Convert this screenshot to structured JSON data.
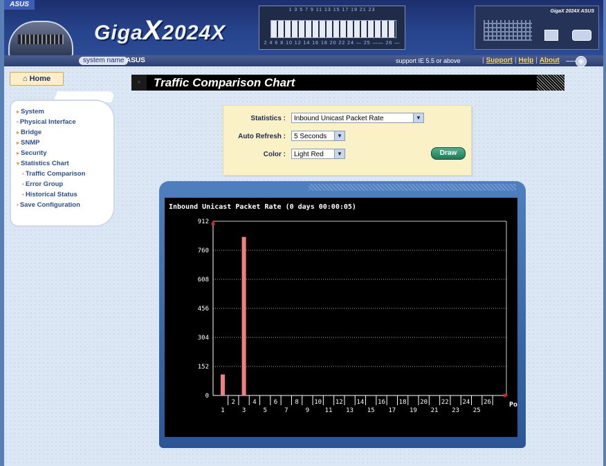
{
  "header": {
    "asus_logo": "ASUS",
    "brand_prefix": "Giga",
    "brand_x": "X",
    "brand_model": "2024X",
    "port_numbers_top": "1 3 5 7 9 11 13 15 17 19 21 23",
    "port_numbers_bottom": "2 4 6 8 10 12 14 16 18 20 22 24 — 25 —— 26 —",
    "device_label": "GigaX 2024X ASUS"
  },
  "statusbar": {
    "system_name_label": "system name",
    "system_name_value": "ASUS",
    "support_note": "support IE 5.5 or above",
    "links": {
      "support": "Support",
      "help": "Help",
      "about": "About"
    }
  },
  "nav": {
    "home": "Home",
    "items": [
      {
        "label": "System"
      },
      {
        "label": "Physical Interface"
      },
      {
        "label": "Bridge"
      },
      {
        "label": "SNMP"
      },
      {
        "label": "Security"
      },
      {
        "label": "Statistics Chart"
      },
      {
        "label": "Traffic Comparison"
      },
      {
        "label": "Error Group"
      },
      {
        "label": "Historical Status"
      },
      {
        "label": "Save Configuration"
      }
    ]
  },
  "page": {
    "title": "Traffic Comparison Chart"
  },
  "form": {
    "statistics_label": "Statistics :",
    "statistics_value": "Inbound Unicast Packet Rate",
    "refresh_label": "Auto Refresh :",
    "refresh_value": "5 Seconds",
    "color_label": "Color :",
    "color_value": "Light Red",
    "draw_button": "Draw"
  },
  "chart_data": {
    "type": "bar",
    "title": "Inbound Unicast Packet Rate (0 days 00:00:05)",
    "xlabel": "Port",
    "ylabel": "",
    "categories": [
      "1",
      "2",
      "3",
      "4",
      "5",
      "6",
      "7",
      "8",
      "9",
      "10",
      "11",
      "12",
      "13",
      "14",
      "15",
      "16",
      "17",
      "18",
      "19",
      "20",
      "21",
      "22",
      "23",
      "24",
      "25",
      "26"
    ],
    "values": [
      110,
      0,
      830,
      0,
      0,
      0,
      0,
      0,
      0,
      0,
      0,
      0,
      0,
      0,
      0,
      0,
      0,
      0,
      0,
      0,
      0,
      0,
      0,
      0,
      0,
      0
    ],
    "ylim": [
      0,
      912
    ],
    "yticks": [
      "0",
      "152",
      "304",
      "456",
      "608",
      "760",
      "912"
    ],
    "grid": true,
    "bar_color": "#f08080",
    "background": "#000000"
  }
}
